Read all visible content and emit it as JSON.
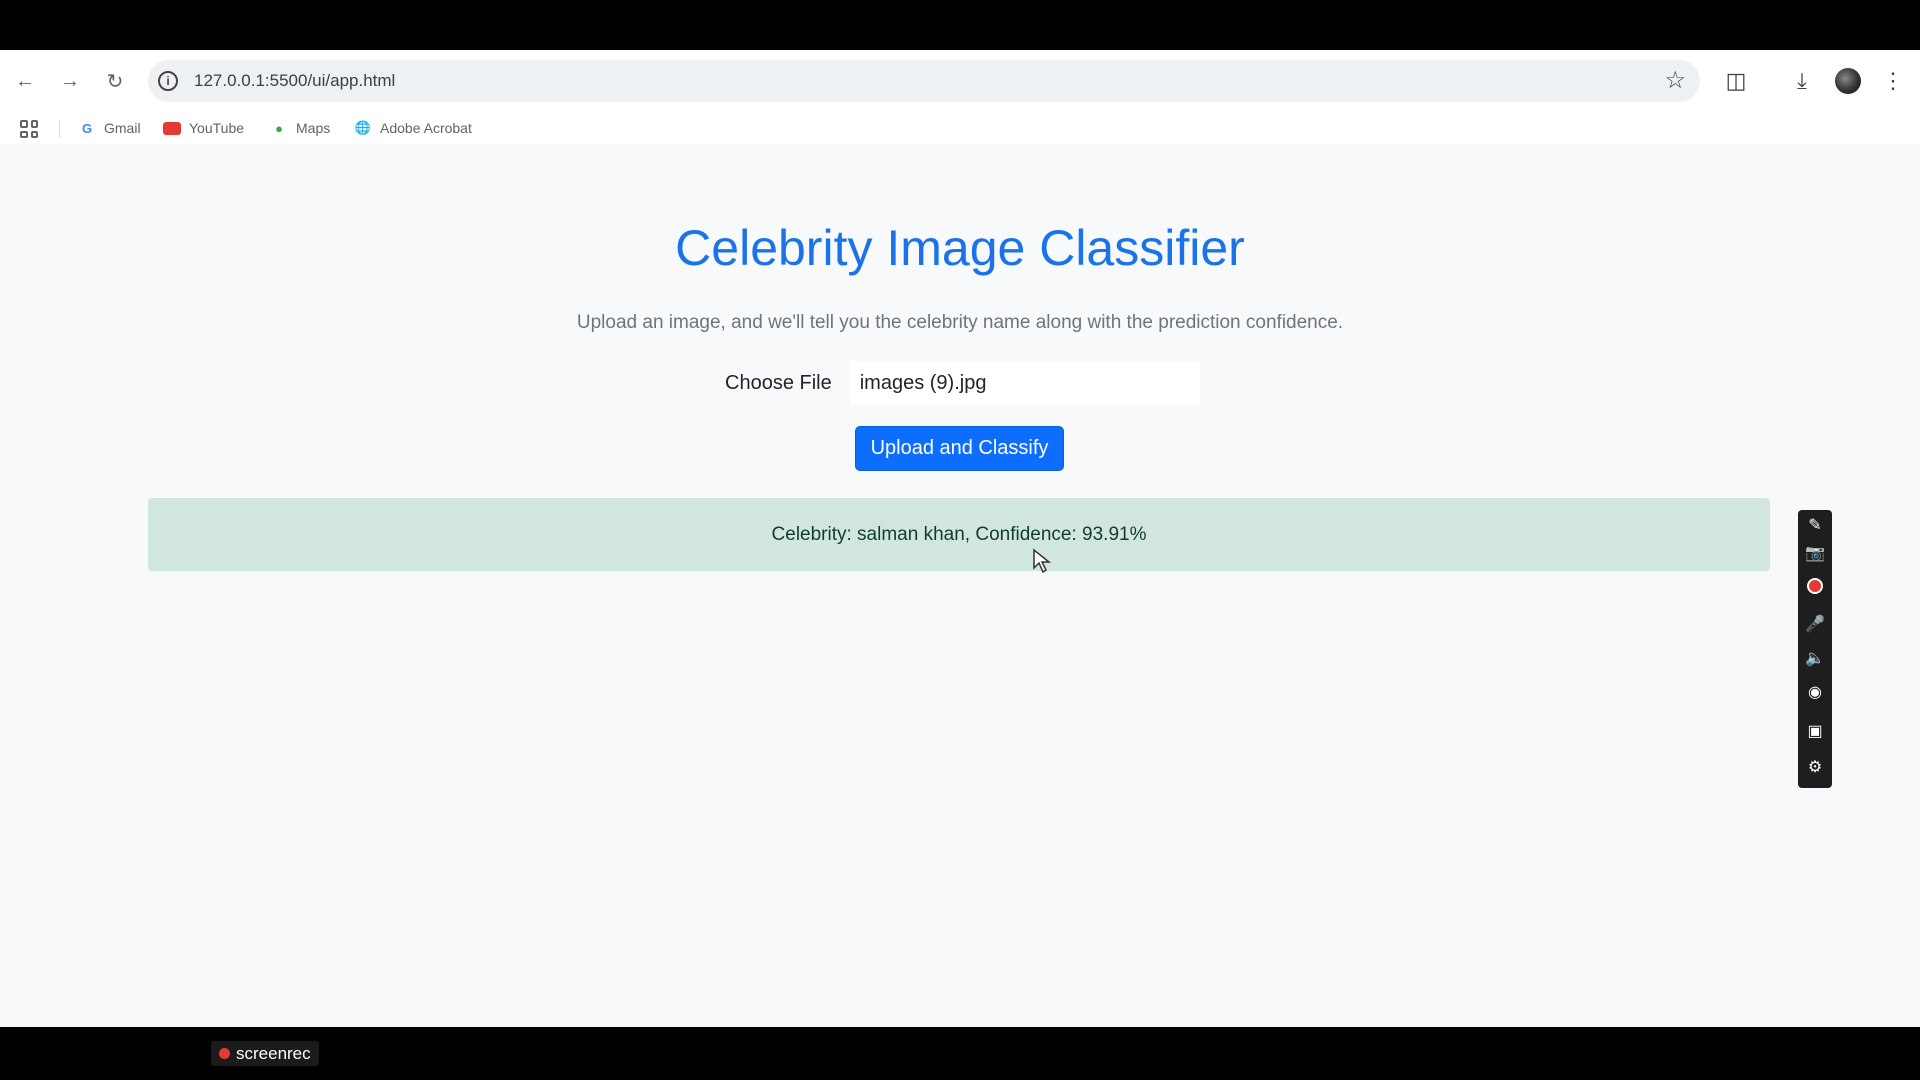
{
  "browser": {
    "url": "127.0.0.1:5500/ui/app.html",
    "icons": {
      "back": "back-arrow-icon",
      "forward": "forward-arrow-icon",
      "reload": "reload-icon",
      "site_info": "site-info-icon",
      "bookmark_star": "star-icon",
      "extensions": "puzzle-icon",
      "download": "download-icon",
      "menu": "kebab-menu-icon"
    }
  },
  "bookmarks": [
    {
      "label": "Gmail"
    },
    {
      "label": "YouTube"
    },
    {
      "label": "Maps"
    },
    {
      "label": "Adobe Acrobat"
    }
  ],
  "page": {
    "title": "Celebrity Image Classifier",
    "subtitle": "Upload an image, and we'll tell you the celebrity name along with the prediction confidence.",
    "choose_file_label": "Choose File",
    "file_name": "images (9).jpg",
    "upload_button": "Upload and Classify",
    "result_text": "Celebrity: salman khan, Confidence: 93.91%"
  },
  "recorder_watermark": "screenrec",
  "colors": {
    "title": "#1a73e8",
    "primary_button": "#0d6efd",
    "result_bg": "#d1e7dd",
    "page_bg": "#f8f9fa"
  }
}
